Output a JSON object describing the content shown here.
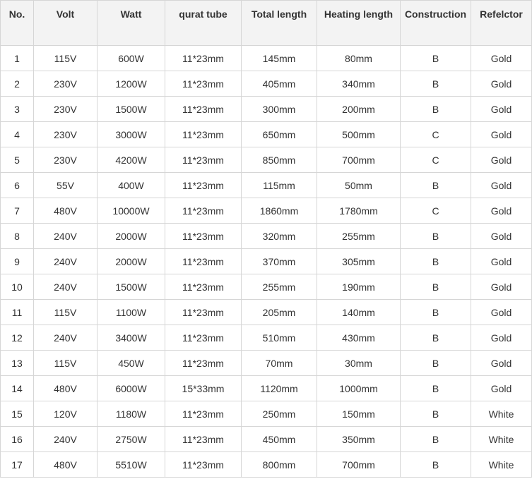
{
  "table": {
    "headers": [
      "No.",
      "Volt",
      "Watt",
      "qurat tube",
      "Total length",
      "Heating length",
      "Construction",
      "Refelctor"
    ],
    "rows": [
      [
        "1",
        "115V",
        "600W",
        "11*23mm",
        "145mm",
        "80mm",
        "B",
        "Gold"
      ],
      [
        "2",
        "230V",
        "1200W",
        "11*23mm",
        "405mm",
        "340mm",
        "B",
        "Gold"
      ],
      [
        "3",
        "230V",
        "1500W",
        "11*23mm",
        "300mm",
        "200mm",
        "B",
        "Gold"
      ],
      [
        "4",
        "230V",
        "3000W",
        "11*23mm",
        "650mm",
        "500mm",
        "C",
        "Gold"
      ],
      [
        "5",
        "230V",
        "4200W",
        "11*23mm",
        "850mm",
        "700mm",
        "C",
        "Gold"
      ],
      [
        "6",
        "55V",
        "400W",
        "11*23mm",
        "115mm",
        "50mm",
        "B",
        "Gold"
      ],
      [
        "7",
        "480V",
        "10000W",
        "11*23mm",
        "1860mm",
        "1780mm",
        "C",
        "Gold"
      ],
      [
        "8",
        "240V",
        "2000W",
        "11*23mm",
        "320mm",
        "255mm",
        "B",
        "Gold"
      ],
      [
        "9",
        "240V",
        "2000W",
        "11*23mm",
        "370mm",
        "305mm",
        "B",
        "Gold"
      ],
      [
        "10",
        "240V",
        "1500W",
        "11*23mm",
        "255mm",
        "190mm",
        "B",
        "Gold"
      ],
      [
        "11",
        "115V",
        "1100W",
        "11*23mm",
        "205mm",
        "140mm",
        "B",
        "Gold"
      ],
      [
        "12",
        "240V",
        "3400W",
        "11*23mm",
        "510mm",
        "430mm",
        "B",
        "Gold"
      ],
      [
        "13",
        "115V",
        "450W",
        "11*23mm",
        "70mm",
        "30mm",
        "B",
        "Gold"
      ],
      [
        "14",
        "480V",
        "6000W",
        "15*33mm",
        "1120mm",
        "1000mm",
        "B",
        "Gold"
      ],
      [
        "15",
        "120V",
        "1180W",
        "11*23mm",
        "250mm",
        "150mm",
        "B",
        "White"
      ],
      [
        "16",
        "240V",
        "2750W",
        "11*23mm",
        "450mm",
        "350mm",
        "B",
        "White"
      ],
      [
        "17",
        "480V",
        "5510W",
        "11*23mm",
        "800mm",
        "700mm",
        "B",
        "White"
      ]
    ]
  }
}
